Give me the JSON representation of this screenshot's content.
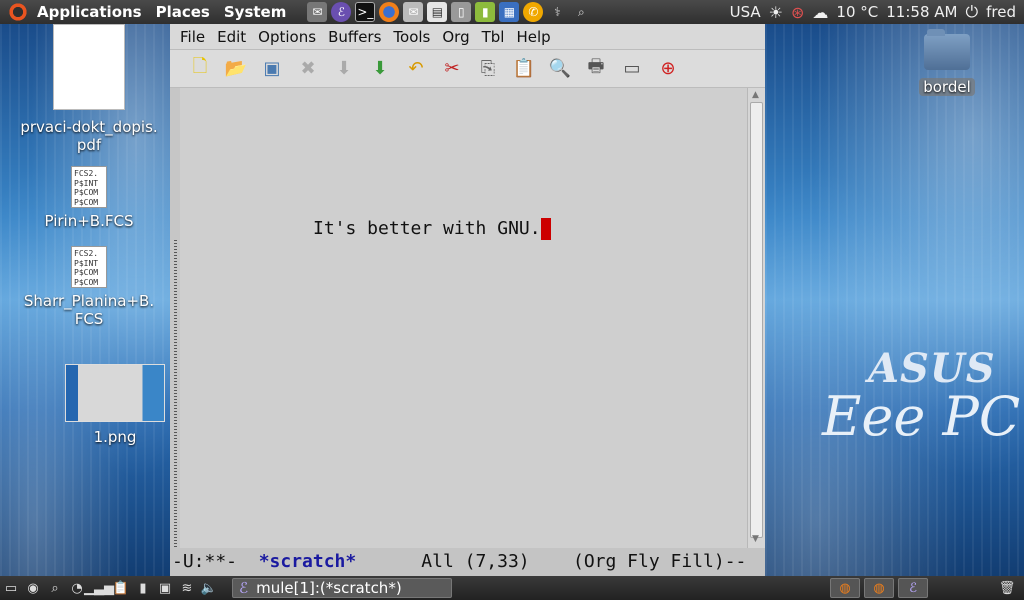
{
  "top_panel": {
    "menus": [
      "Applications",
      "Places",
      "System"
    ],
    "keyboard_layout": "USA",
    "weather": "10 °C",
    "clock": "11:58 AM",
    "user": "fred"
  },
  "desktop": {
    "icons": [
      {
        "label": "prvaci-dokt_dopis.\npdf"
      },
      {
        "label": "Pirin+B.FCS"
      },
      {
        "label": "Sharr_Planina+B.\nFCS"
      },
      {
        "label": "1.png"
      },
      {
        "label": "bordel"
      }
    ],
    "fcs_preview": "FCS2.\nP$INT\nP$COM\nP$COM",
    "brand_top": "ASUS",
    "brand_bottom": "Eee PC"
  },
  "emacs": {
    "menus": [
      "File",
      "Edit",
      "Options",
      "Buffers",
      "Tools",
      "Org",
      "Tbl",
      "Help"
    ],
    "buffer_text": "It's better with GNU.",
    "modeline": {
      "left": "-U:**-  ",
      "buffer_name": "*scratch*",
      "right": "      All (7,33)    (Org Fly Fill)--"
    }
  },
  "bottom_panel": {
    "task_label": "mule[1]:(*scratch*)"
  }
}
